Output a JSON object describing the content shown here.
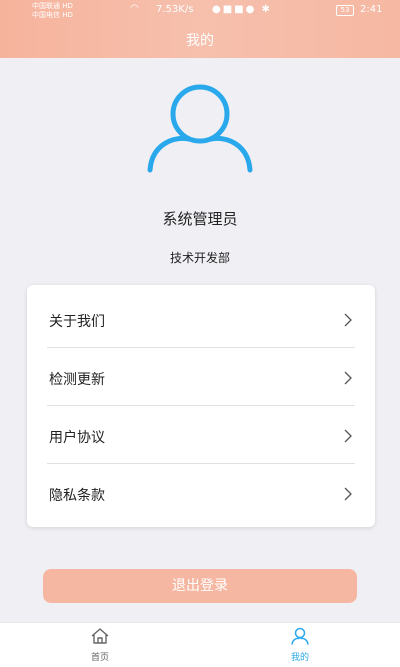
{
  "status_bar": {
    "carrier1": "中国联通 HD",
    "carrier2": "中国电信 HD",
    "net_speed": "7.53K/s",
    "battery": "53",
    "time": "2:41"
  },
  "header": {
    "title": "我的"
  },
  "profile": {
    "name": "系统管理员",
    "department": "技术开发部"
  },
  "menu": {
    "items": [
      {
        "label": "关于我们"
      },
      {
        "label": "检测更新"
      },
      {
        "label": "用户协议"
      },
      {
        "label": "隐私条款"
      }
    ]
  },
  "logout_label": "退出登录",
  "tabbar": {
    "tabs": [
      {
        "label": "首页",
        "icon": "home-icon",
        "active": false
      },
      {
        "label": "我的",
        "icon": "user-icon",
        "active": true
      }
    ]
  },
  "colors": {
    "accent": "#f6b39c",
    "avatar_blue": "#29a9ec",
    "active_tab": "#29a9ec",
    "inactive_tab": "#666666"
  }
}
